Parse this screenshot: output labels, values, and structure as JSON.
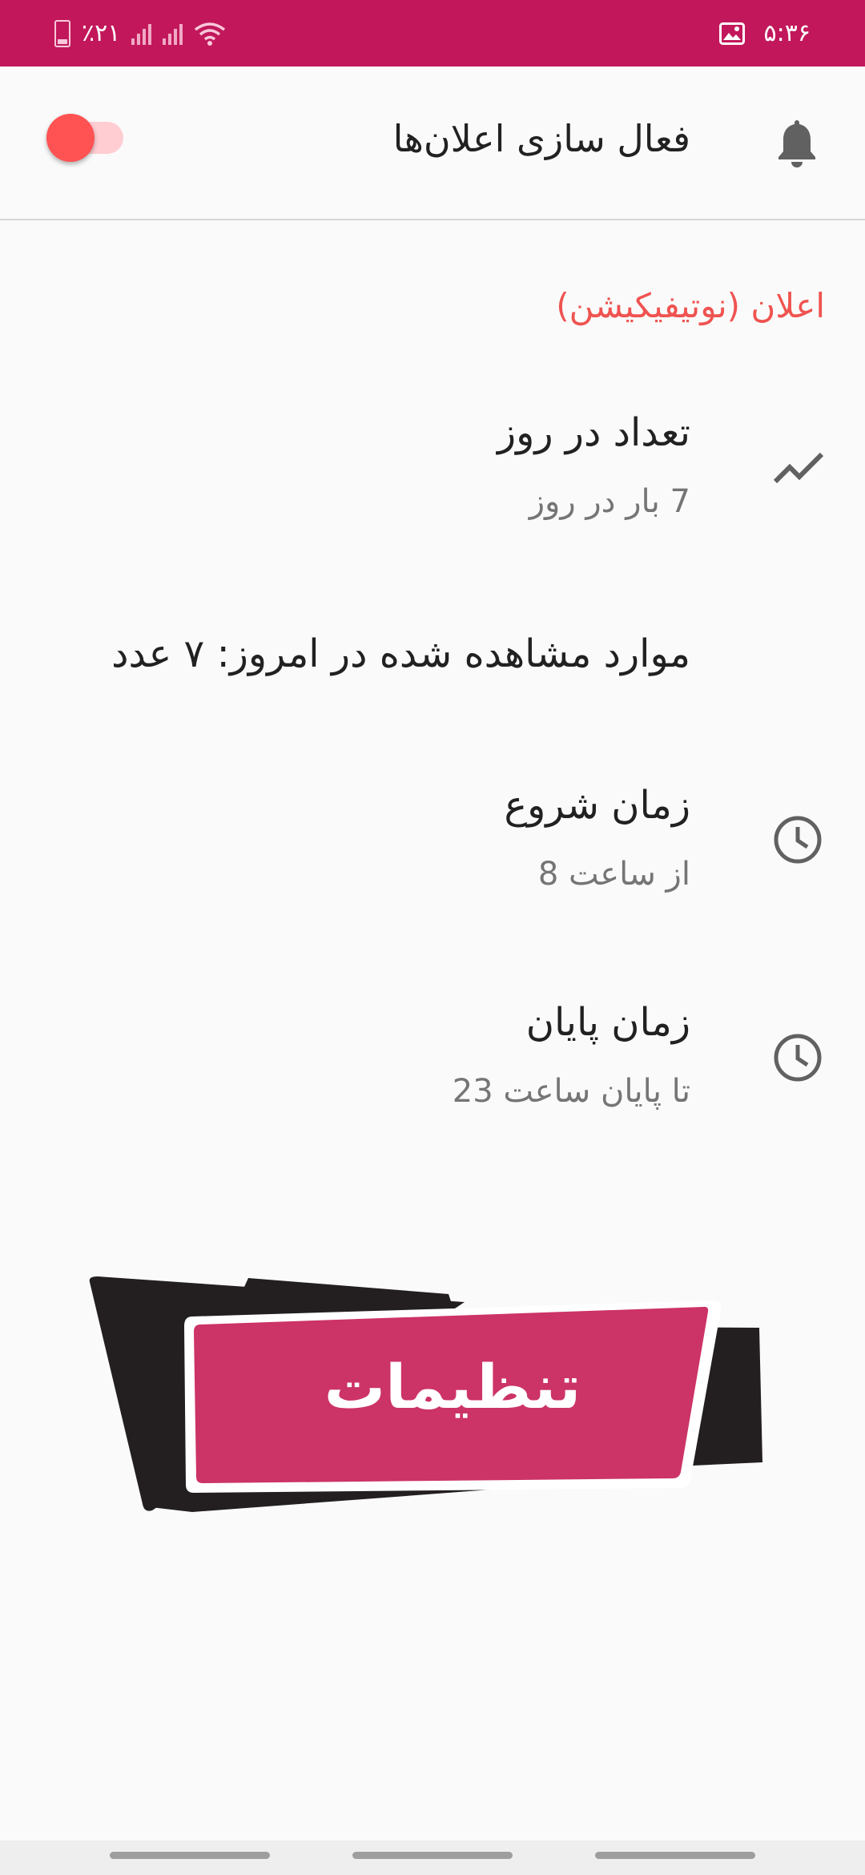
{
  "status_bar": {
    "time": "۵:۳۶",
    "battery_percent": "٪۲۱",
    "icons": [
      "battery-icon",
      "signal-icon",
      "signal-icon",
      "wifi-icon",
      "image-icon"
    ]
  },
  "header": {
    "enable_label": "فعال سازی اعلان‌ها",
    "toggle_on": true,
    "icon": "bell-icon"
  },
  "section": {
    "title": "اعلان (نوتیفیکیشن)"
  },
  "settings_rows": [
    {
      "title": "تعداد در روز",
      "subtitle": "7 بار در روز",
      "icon": "trending-icon"
    },
    {
      "title": "موارد مشاهده شده در امروز: ۷ عدد"
    },
    {
      "title": "زمان شروع",
      "subtitle": "از ساعت 8",
      "icon": "clock-icon"
    },
    {
      "title": "زمان پایان",
      "subtitle": "تا پایان ساعت 23",
      "icon": "clock-icon"
    }
  ],
  "banner": {
    "label": "تنظیمات"
  },
  "colors": {
    "status_bar": "#c2185b",
    "accent": "#ef5350",
    "toggle_knob": "#ff5252",
    "toggle_track": "#ffcdd2",
    "banner_fill": "#cc3366",
    "banner_back": "#231f20",
    "icon_gray": "#616161"
  }
}
